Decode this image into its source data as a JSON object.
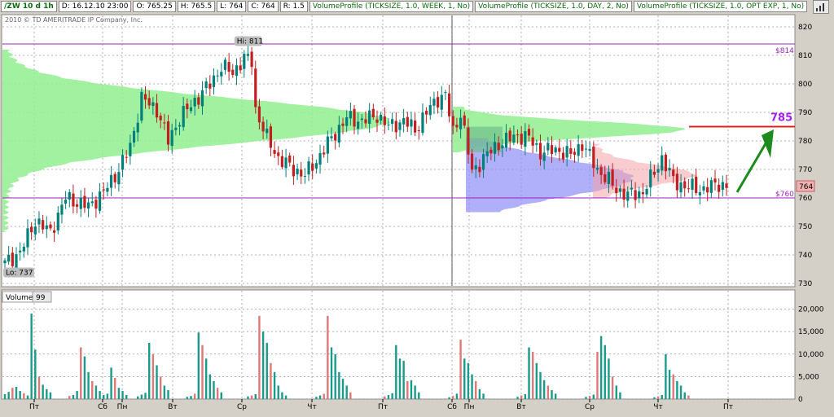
{
  "header": {
    "symbol": "/ZW 10 d 1h",
    "date": "D: 16.12.10 23:00",
    "open": "O: 765.25",
    "high": "H: 765.5",
    "low": "L: 764",
    "close": "C: 764",
    "range": "R: 1.5",
    "studies": [
      "VolumeProfile (TICKSIZE, 1.0, WEEK, 1, No)",
      "VolumeProfile (TICKSIZE, 1.0, DAY, 2, No)",
      "VolumeProfile (TICKSIZE, 1.0, OPT EXP, 1, No)"
    ]
  },
  "copyright": "2010 © TD AMERITRADE IP Company, Inc.",
  "annotations": {
    "hi": "Hi: 811",
    "lo": "Lo: 737",
    "last": "764",
    "level_814": "$814",
    "level_760": "$760",
    "target": "785"
  },
  "colors": {
    "up": "#00807a",
    "down": "#c21f1f",
    "week_profile": "#90ee90",
    "day_profile": "#8e8ef8",
    "optexp_profile": "#f4a3a8",
    "level_line": "#a020c0",
    "target_line": "#e02020",
    "arrow": "#1c8a1c",
    "vol_up": "#1a9a8a",
    "vol_down": "#e07878"
  },
  "chart_data": [
    {
      "type": "candlestick",
      "title": "/ZW 10 d 1h",
      "ylim": [
        730,
        822
      ],
      "y_ticks": [
        730,
        740,
        750,
        760,
        770,
        780,
        790,
        800,
        810,
        820
      ],
      "x_ticks": [
        "Пт",
        "Сб",
        "Пн",
        "Вт",
        "Ср",
        "Чт",
        "Пт",
        "Сб",
        "Пн",
        "Вт",
        "Ср",
        "Чт",
        "Пт"
      ],
      "horizontal_levels": [
        814,
        760
      ],
      "target_level": 785,
      "close_path": [
        [
          0,
          737
        ],
        [
          4,
          741
        ],
        [
          8,
          752
        ],
        [
          12,
          748
        ],
        [
          16,
          760
        ],
        [
          22,
          757
        ],
        [
          26,
          762
        ],
        [
          30,
          770
        ],
        [
          33,
          778
        ],
        [
          36,
          795
        ],
        [
          40,
          791
        ],
        [
          43,
          780
        ],
        [
          46,
          788
        ],
        [
          50,
          794
        ],
        [
          54,
          800
        ],
        [
          57,
          806
        ],
        [
          60,
          804
        ],
        [
          63,
          809
        ],
        [
          65,
          808
        ],
        [
          66,
          791
        ],
        [
          69,
          781
        ],
        [
          72,
          774
        ],
        [
          76,
          770
        ],
        [
          79,
          768
        ],
        [
          82,
          773
        ],
        [
          86,
          781
        ],
        [
          90,
          788
        ],
        [
          94,
          787
        ],
        [
          98,
          789
        ],
        [
          101,
          785
        ],
        [
          105,
          787
        ],
        [
          108,
          784
        ],
        [
          111,
          790
        ],
        [
          114,
          795
        ],
        [
          116,
          796
        ],
        [
          118,
          783
        ],
        [
          120,
          790
        ],
        [
          123,
          769
        ],
        [
          126,
          774
        ],
        [
          130,
          779
        ],
        [
          135,
          782
        ],
        [
          138,
          781
        ],
        [
          141,
          776
        ],
        [
          145,
          777
        ],
        [
          149,
          775
        ],
        [
          152,
          779
        ],
        [
          156,
          770
        ],
        [
          159,
          766
        ],
        [
          161,
          763
        ],
        [
          164,
          761
        ],
        [
          168,
          762
        ],
        [
          171,
          769
        ],
        [
          173,
          774
        ],
        [
          176,
          766
        ],
        [
          179,
          764
        ],
        [
          184,
          763
        ],
        [
          188,
          765
        ],
        [
          190,
          764
        ]
      ]
    },
    {
      "type": "bar",
      "title": "Volume",
      "value_label": "99",
      "ylim": [
        0,
        21000
      ],
      "y_ticks": [
        0,
        5000,
        10000,
        15000,
        20000
      ],
      "y_tick_labels": [
        "0",
        "5,000",
        "10,000",
        "15,000",
        "20,000"
      ],
      "sessions": [
        {
          "start": 0,
          "values": [
            1100,
            1600,
            2500,
            2700,
            1800,
            1300,
            800,
            19000,
            11000,
            5000,
            3200,
            2200,
            1500
          ]
        },
        {
          "start": 17,
          "values": [
            700,
            900,
            1800,
            11500,
            9500,
            6000,
            4000,
            3000,
            1800,
            900
          ]
        },
        {
          "start": 27,
          "values": [
            1200,
            7000,
            4700,
            2500,
            1800,
            900
          ]
        },
        {
          "start": 35,
          "values": [
            600,
            1000,
            1400,
            12500,
            10000,
            7500,
            5000,
            3000,
            2000
          ]
        },
        {
          "start": 48,
          "values": [
            500,
            700,
            1200,
            14800,
            12000,
            9000,
            5500,
            4000,
            2500,
            1500
          ]
        },
        {
          "start": 64,
          "values": [
            600,
            800,
            1100,
            18500,
            15000,
            12500,
            8000,
            6000,
            3000,
            1500,
            800
          ]
        },
        {
          "start": 82,
          "values": [
            500,
            800,
            1200,
            18500,
            11500,
            10000,
            6000,
            4500,
            3000,
            1500
          ]
        },
        {
          "start": 100,
          "values": [
            600,
            900,
            1300,
            12000,
            9000,
            8500,
            4000,
            4200,
            3000,
            1500
          ]
        },
        {
          "start": 117,
          "values": [
            400,
            700,
            1200,
            13200,
            9000,
            8000,
            5500,
            4000,
            2200,
            1200
          ]
        },
        {
          "start": 135,
          "values": [
            500,
            800,
            1100,
            11500,
            10500,
            8000,
            6000,
            4200,
            3000,
            2000,
            1200
          ]
        },
        {
          "start": 153,
          "values": [
            500,
            700,
            1000,
            10500,
            14000,
            12000,
            9000,
            5000,
            3000,
            1500
          ]
        },
        {
          "start": 171,
          "values": [
            400,
            600,
            900,
            10000,
            6500,
            5500,
            4000,
            3000,
            1500,
            800
          ]
        }
      ],
      "down_positions": [
        2,
        5,
        9,
        17,
        20,
        23,
        29,
        33,
        39,
        41,
        44,
        50,
        52,
        56,
        60,
        65,
        67,
        70,
        76,
        84,
        85,
        91,
        95,
        100,
        106,
        112,
        118,
        120,
        124,
        130,
        136,
        139,
        143,
        148,
        154,
        156,
        160,
        166,
        172,
        176,
        180
      ]
    }
  ]
}
